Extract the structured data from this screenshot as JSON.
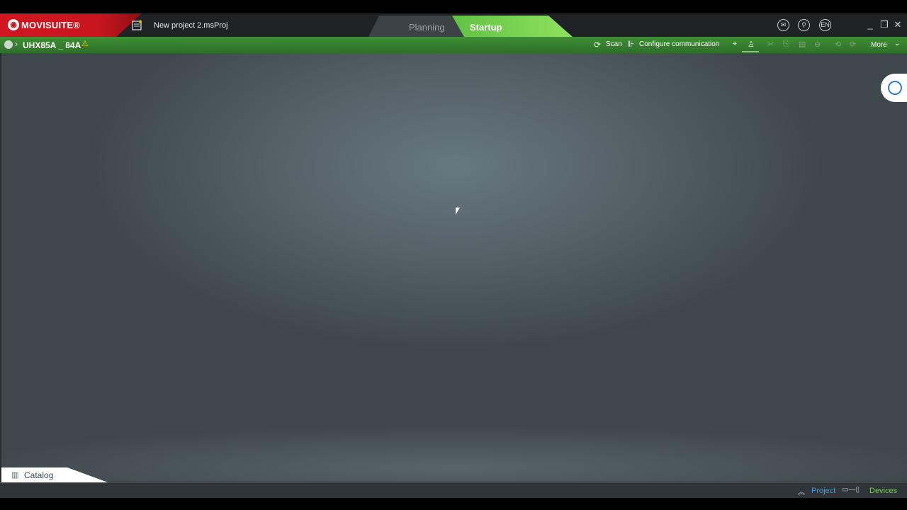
{
  "app": {
    "brand_name": "MOVISUITE®",
    "project_name": "New project 2.msProj"
  },
  "tabs": [
    {
      "label": "Planning",
      "active": false
    },
    {
      "label": "Startup",
      "active": true
    }
  ],
  "title_icons": [
    "mail-icon",
    "search-icon",
    "language-icon"
  ],
  "language": "EN",
  "toolbar": {
    "device_name": "UHX85A _ 84A",
    "scan_label": "Scan",
    "configure_label": "Configure communication",
    "more_label": "More"
  },
  "catalog": {
    "label": "Catalog"
  },
  "status": {
    "project_label": "Project",
    "devices_label": "Devices"
  },
  "colors": {
    "brand_red": "#c8151e",
    "startup_green": "#72d04b",
    "project_blue": "#3d9fe0"
  }
}
